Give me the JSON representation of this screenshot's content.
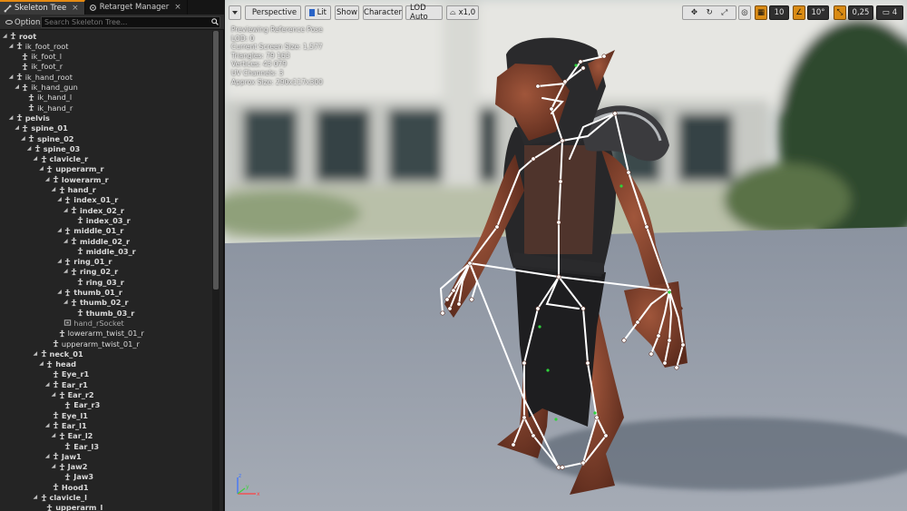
{
  "tabs": [
    {
      "label": "Skeleton Tree",
      "active": true
    },
    {
      "label": "Retarget Manager",
      "active": false
    }
  ],
  "options_label": "Options",
  "search": {
    "placeholder": "Search Skeleton Tree..."
  },
  "tree": [
    {
      "label": "root",
      "depth": 0,
      "type": "bone",
      "bold": true
    },
    {
      "label": "ik_foot_root",
      "depth": 1,
      "type": "bone"
    },
    {
      "label": "ik_foot_l",
      "depth": 2,
      "type": "bone"
    },
    {
      "label": "ik_foot_r",
      "depth": 2,
      "type": "bone"
    },
    {
      "label": "ik_hand_root",
      "depth": 1,
      "type": "bone"
    },
    {
      "label": "ik_hand_gun",
      "depth": 2,
      "type": "bone"
    },
    {
      "label": "ik_hand_l",
      "depth": 3,
      "type": "bone"
    },
    {
      "label": "ik_hand_r",
      "depth": 3,
      "type": "bone"
    },
    {
      "label": "pelvis",
      "depth": 1,
      "type": "bone",
      "bold": true
    },
    {
      "label": "spine_01",
      "depth": 2,
      "type": "bone",
      "bold": true
    },
    {
      "label": "spine_02",
      "depth": 3,
      "type": "bone",
      "bold": true
    },
    {
      "label": "spine_03",
      "depth": 4,
      "type": "bone",
      "bold": true
    },
    {
      "label": "clavicle_r",
      "depth": 5,
      "type": "bone",
      "bold": true
    },
    {
      "label": "upperarm_r",
      "depth": 6,
      "type": "bone",
      "bold": true
    },
    {
      "label": "lowerarm_r",
      "depth": 7,
      "type": "bone",
      "bold": true
    },
    {
      "label": "hand_r",
      "depth": 8,
      "type": "bone",
      "bold": true
    },
    {
      "label": "index_01_r",
      "depth": 9,
      "type": "bone",
      "bold": true
    },
    {
      "label": "index_02_r",
      "depth": 10,
      "type": "bone",
      "bold": true
    },
    {
      "label": "index_03_r",
      "depth": 11,
      "type": "bone",
      "bold": true
    },
    {
      "label": "middle_01_r",
      "depth": 9,
      "type": "bone",
      "bold": true
    },
    {
      "label": "middle_02_r",
      "depth": 10,
      "type": "bone",
      "bold": true
    },
    {
      "label": "middle_03_r",
      "depth": 11,
      "type": "bone",
      "bold": true
    },
    {
      "label": "ring_01_r",
      "depth": 9,
      "type": "bone",
      "bold": true
    },
    {
      "label": "ring_02_r",
      "depth": 10,
      "type": "bone",
      "bold": true
    },
    {
      "label": "ring_03_r",
      "depth": 11,
      "type": "bone",
      "bold": true
    },
    {
      "label": "thumb_01_r",
      "depth": 9,
      "type": "bone",
      "bold": true
    },
    {
      "label": "thumb_02_r",
      "depth": 10,
      "type": "bone",
      "bold": true
    },
    {
      "label": "thumb_03_r",
      "depth": 11,
      "type": "bone",
      "bold": true
    },
    {
      "label": "hand_rSocket",
      "depth": 9,
      "type": "socket"
    },
    {
      "label": "lowerarm_twist_01_r",
      "depth": 8,
      "type": "bone"
    },
    {
      "label": "upperarm_twist_01_r",
      "depth": 7,
      "type": "bone"
    },
    {
      "label": "neck_01",
      "depth": 5,
      "type": "bone",
      "bold": true
    },
    {
      "label": "head",
      "depth": 6,
      "type": "bone",
      "bold": true
    },
    {
      "label": "Eye_r1",
      "depth": 7,
      "type": "bone",
      "bold": true
    },
    {
      "label": "Ear_r1",
      "depth": 7,
      "type": "bone",
      "bold": true
    },
    {
      "label": "Ear_r2",
      "depth": 8,
      "type": "bone",
      "bold": true
    },
    {
      "label": "Ear_r3",
      "depth": 9,
      "type": "bone",
      "bold": true
    },
    {
      "label": "Eye_l1",
      "depth": 7,
      "type": "bone",
      "bold": true
    },
    {
      "label": "Ear_l1",
      "depth": 7,
      "type": "bone",
      "bold": true
    },
    {
      "label": "Ear_l2",
      "depth": 8,
      "type": "bone",
      "bold": true
    },
    {
      "label": "Ear_l3",
      "depth": 9,
      "type": "bone",
      "bold": true
    },
    {
      "label": "Jaw1",
      "depth": 7,
      "type": "bone",
      "bold": true
    },
    {
      "label": "Jaw2",
      "depth": 8,
      "type": "bone",
      "bold": true
    },
    {
      "label": "Jaw3",
      "depth": 9,
      "type": "bone",
      "bold": true
    },
    {
      "label": "Hood1",
      "depth": 7,
      "type": "bone",
      "bold": true
    },
    {
      "label": "clavicle_l",
      "depth": 5,
      "type": "bone",
      "bold": true
    },
    {
      "label": "upperarm_l",
      "depth": 6,
      "type": "bone",
      "bold": true
    }
  ],
  "viewport": {
    "toolbar": {
      "perspective": "Perspective",
      "lit": "Lit",
      "show": "Show",
      "character": "Character",
      "lod": "LOD Auto",
      "speed": "x1,0",
      "grid_snap": "10",
      "rot_snap": "10°",
      "scale_snap": "0,25",
      "camera_speed": "4"
    },
    "stats": [
      "Previewing Reference Pose",
      "LOD: 0",
      "Current Screen Size: 1,577",
      "Triangles: 79 163",
      "Vertices: 43 079",
      "UV Channels: 3",
      "Approx Size: 290x117x300"
    ]
  },
  "colors": {
    "accent": "#e58a12",
    "panel_bg": "#242424",
    "bone_line": "#ffffff",
    "floor": "#8f97a3"
  }
}
